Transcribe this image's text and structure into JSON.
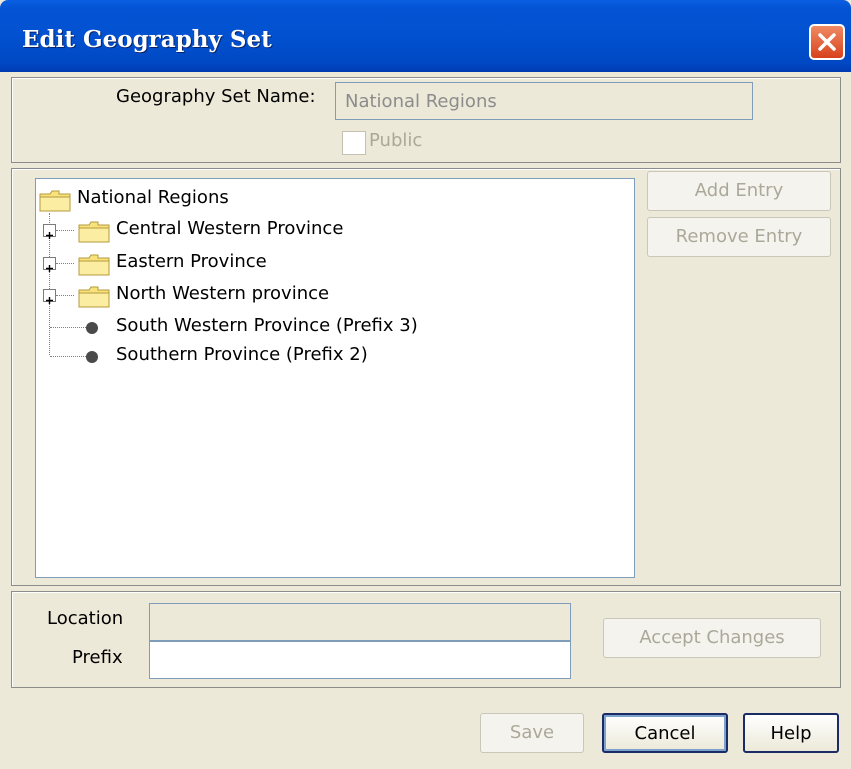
{
  "window": {
    "title": "Edit Geography Set",
    "close_icon": "close-icon"
  },
  "header": {
    "name_label": "Geography Set Name:",
    "name_value": "National Regions",
    "public_label": "Public",
    "public_checked": false
  },
  "tree": {
    "root": {
      "label": "National Regions",
      "icon": "folder-icon"
    },
    "items": [
      {
        "label": "Central Western Province",
        "type": "folder",
        "expandable": true
      },
      {
        "label": "Eastern Province",
        "type": "folder",
        "expandable": true
      },
      {
        "label": "North Western province",
        "type": "folder",
        "expandable": true
      },
      {
        "label": "South Western Province (Prefix 3)",
        "type": "leaf",
        "expandable": false
      },
      {
        "label": "Southern Province (Prefix 2)",
        "type": "leaf",
        "expandable": false
      }
    ]
  },
  "side_buttons": {
    "add_entry": "Add Entry",
    "remove_entry": "Remove Entry"
  },
  "entry": {
    "location_label": "Location",
    "location_value": "",
    "prefix_label": "Prefix",
    "prefix_value": "",
    "accept_changes": "Accept Changes"
  },
  "footer": {
    "save": "Save",
    "cancel": "Cancel",
    "help": "Help"
  },
  "colors": {
    "title_bar": "#0151d0",
    "dialog_bg": "#ece9d8",
    "disabled_text": "#aca899"
  }
}
